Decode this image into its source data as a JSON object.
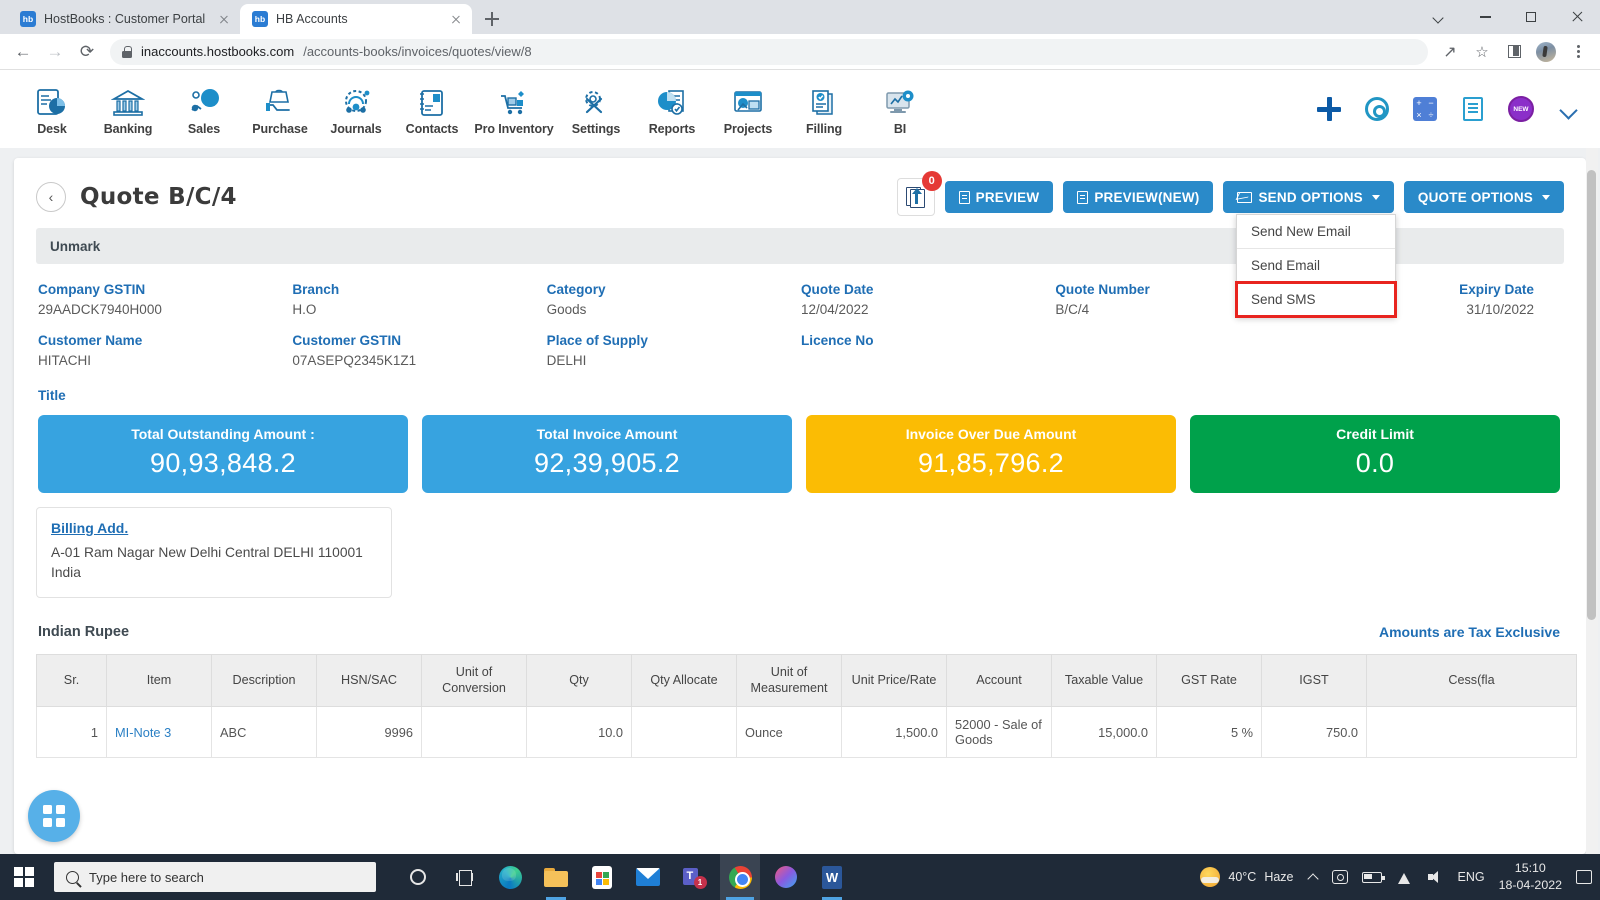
{
  "browser": {
    "tabs": [
      {
        "favicon": "hb",
        "title": "HostBooks : Customer Portal",
        "active": false
      },
      {
        "favicon": "hb",
        "title": "HB Accounts",
        "active": true
      }
    ],
    "url_host": "inaccounts.hostbooks.com",
    "url_path": "/accounts-books/invoices/quotes/view/8",
    "back_glyph": "←",
    "forward_glyph": "→",
    "reload_glyph": "⟳"
  },
  "app_nav": {
    "items": [
      {
        "label": "Desk",
        "icon": "dashboard-icon"
      },
      {
        "label": "Banking",
        "icon": "bank-icon"
      },
      {
        "label": "Sales",
        "icon": "sales-icon"
      },
      {
        "label": "Purchase",
        "icon": "purchase-icon"
      },
      {
        "label": "Journals",
        "icon": "journals-icon"
      },
      {
        "label": "Contacts",
        "icon": "contacts-icon"
      },
      {
        "label": "Pro Inventory",
        "icon": "inventory-icon"
      },
      {
        "label": "Settings",
        "icon": "settings-icon"
      },
      {
        "label": "Reports",
        "icon": "reports-icon"
      },
      {
        "label": "Projects",
        "icon": "projects-icon"
      },
      {
        "label": "Filling",
        "icon": "filling-icon"
      },
      {
        "label": "BI",
        "icon": "bi-icon"
      }
    ],
    "right_icons": [
      "plus-icon",
      "gear-icon",
      "calculator-icon",
      "notes-icon",
      "new-badge-icon",
      "chevron-down-icon"
    ],
    "calculator_glyphs": [
      "+",
      "−",
      "×",
      "÷"
    ],
    "new_badge_text": "NEW"
  },
  "page": {
    "title": "Quote B/C/4",
    "back_glyph": "‹",
    "upload_badge": "0",
    "buttons": {
      "preview": "PREVIEW",
      "preview_new": "PREVIEW(NEW)",
      "send_options": "SEND OPTIONS",
      "quote_options": "QUOTE OPTIONS"
    },
    "send_menu": [
      {
        "label": "Send New Email",
        "highlighted": false
      },
      {
        "label": "Send Email",
        "highlighted": false
      },
      {
        "label": "Send SMS",
        "highlighted": true
      }
    ],
    "status_bar": "Unmark",
    "fields": [
      {
        "label": "Company GSTIN",
        "value": "29AADCK7940H000"
      },
      {
        "label": "Branch",
        "value": "H.O"
      },
      {
        "label": "Category",
        "value": "Goods"
      },
      {
        "label": "Quote Date",
        "value": "12/04/2022"
      },
      {
        "label": "Quote Number",
        "value": "B/C/4"
      },
      {
        "label": "Expiry Date",
        "value": "31/10/2022"
      },
      {
        "label": "Customer Name",
        "value": "HITACHI"
      },
      {
        "label": "Customer GSTIN",
        "value": "07ASEPQ2345K1Z1"
      },
      {
        "label": "Place of Supply",
        "value": "DELHI"
      },
      {
        "label": "Licence No",
        "value": ""
      },
      {
        "label": "",
        "value": ""
      },
      {
        "label": "",
        "value": ""
      }
    ],
    "title_label": "Title",
    "amount_cards": [
      {
        "label": "Total Outstanding Amount :",
        "value": "90,93,848.2",
        "color": "#37a3e0"
      },
      {
        "label": "Total Invoice Amount",
        "value": "92,39,905.2",
        "color": "#37a3e0"
      },
      {
        "label": "Invoice Over Due Amount",
        "value": "91,85,796.2",
        "color": "#fbbc04"
      },
      {
        "label": "Credit Limit",
        "value": "0.0",
        "color": "#00a14b"
      }
    ],
    "billing": {
      "title": "Billing Add.",
      "line1": "A-01 Ram Nagar New Delhi Central DELHI 110001",
      "line2": "India"
    },
    "currency_label": "Indian Rupee",
    "tax_note": "Amounts are Tax Exclusive",
    "table": {
      "columns": [
        "Sr.",
        "Item",
        "Description",
        "HSN/SAC",
        "Unit of Conversion",
        "Qty",
        "Qty Allocate",
        "Unit of Measurement",
        "Unit Price/Rate",
        "Account",
        "Taxable Value",
        "GST Rate",
        "IGST",
        "Cess(fla"
      ],
      "rows": [
        {
          "sr": "1",
          "item": "MI-Note 3",
          "description": "ABC",
          "hsn_sac": "9996",
          "unit_of_conversion": "",
          "qty": "10.0",
          "qty_allocate": "",
          "unit_of_measurement": "Ounce",
          "unit_price": "1,500.0",
          "account": "52000 - Sale of Goods",
          "taxable_value": "15,000.0",
          "gst_rate": "5 %",
          "igst": "750.0",
          "cess": ""
        }
      ]
    },
    "fab_icon": "grid-apps-icon"
  },
  "taskbar": {
    "search_placeholder": "Type here to search",
    "apps": [
      {
        "name": "cortana-icon"
      },
      {
        "name": "task-view-icon"
      },
      {
        "name": "edge-icon"
      },
      {
        "name": "file-explorer-icon"
      },
      {
        "name": "microsoft-store-icon"
      },
      {
        "name": "mail-icon"
      },
      {
        "name": "teams-icon",
        "badge": "1"
      },
      {
        "name": "chrome-icon"
      },
      {
        "name": "paint3d-icon"
      },
      {
        "name": "word-icon"
      }
    ],
    "weather_temp": "40°C",
    "weather_desc": "Haze",
    "language": "ENG",
    "time": "15:10",
    "date": "18-04-2022"
  },
  "colors": {
    "accent_blue": "#2a8ac9",
    "label_blue": "#1f6eb4",
    "card_blue": "#37a3e0",
    "card_yellow": "#fbbc04",
    "card_green": "#00a14b",
    "highlight_red": "#e8241f"
  }
}
